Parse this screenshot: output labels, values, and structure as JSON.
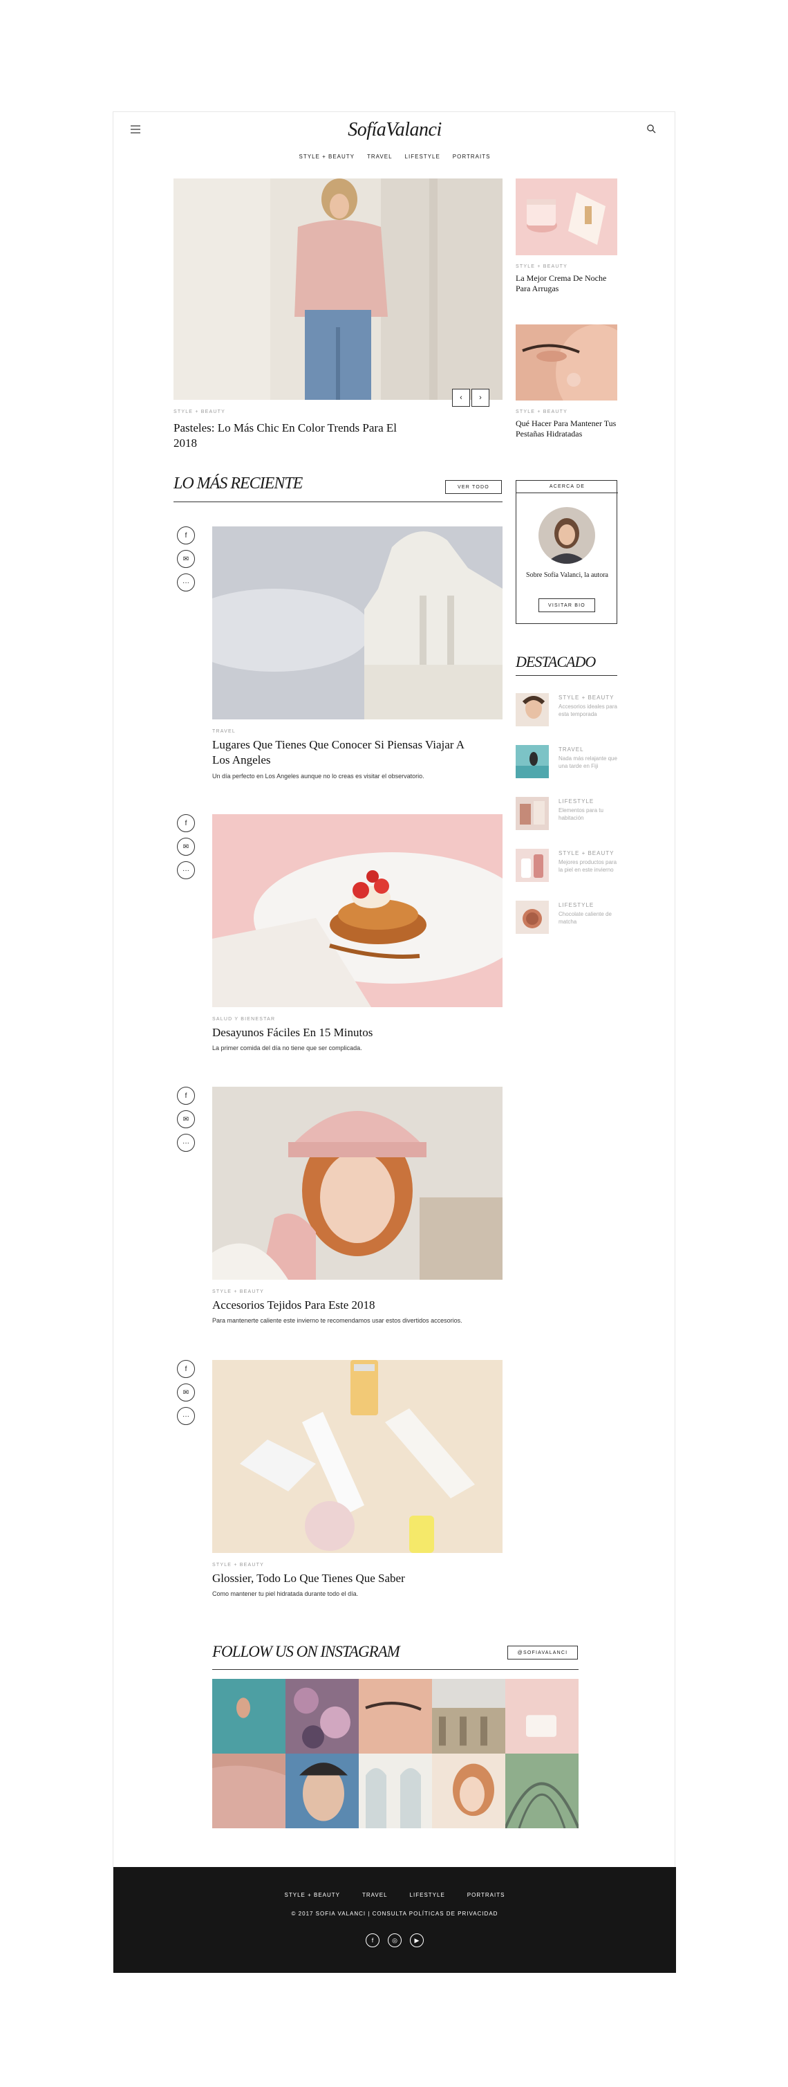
{
  "brand": {
    "logo": "SofíaValanci"
  },
  "nav": [
    "STYLE + BEAUTY",
    "TRAVEL",
    "LIFESTYLE",
    "PORTRAITS"
  ],
  "hero": {
    "category": "STYLE + BEAUTY",
    "title": "Pasteles: Lo Más Chic En Color Trends Para El 2018",
    "prev": "‹",
    "next": "›"
  },
  "side_posts": [
    {
      "category": "STYLE + BEAUTY",
      "title": "La Mejor Crema De Noche Para Arrugas"
    },
    {
      "category": "STYLE + BEAUTY",
      "title": "Qué Hacer Para Mantener Tus Pestañas Hidratadas"
    }
  ],
  "recent": {
    "title": "LO MÁS RECIENTE",
    "view_all": "VER TODO"
  },
  "posts": [
    {
      "category": "TRAVEL",
      "title": "Lugares Que Tienes Que Conocer Si Piensas Viajar A Los Angeles",
      "excerpt": "Un día perfecto en Los Angeles aunque no lo creas es visitar el observatorio."
    },
    {
      "category": "SALUD Y BIENESTAR",
      "title": "Desayunos Fáciles En 15 Minutos",
      "excerpt": "La primer comida del día no tiene que ser complicada."
    },
    {
      "category": "STYLE + BEAUTY",
      "title": "Accesorios Tejidos Para Este 2018",
      "excerpt": "Para mantenerte caliente este invierno te recomendamos usar estos divertidos accesorios."
    },
    {
      "category": "STYLE + BEAUTY",
      "title": "Glossier, Todo Lo Que Tienes Que Saber",
      "excerpt": "Como mantener tu piel hidratada durante todo el día."
    }
  ],
  "share_icons": [
    "f",
    "✉",
    "···"
  ],
  "about": {
    "header": "ACERCA DE",
    "text": "Sobre Sofía Valanci, la autora",
    "button": "VISITAR BIO"
  },
  "featured": {
    "title": "DESTACADO",
    "items": [
      {
        "category": "STYLE + BEAUTY",
        "text": "Accesorios ideales para esta temporada"
      },
      {
        "category": "TRAVEL",
        "text": "Nada más relajante que una tarde en Fiji"
      },
      {
        "category": "LIFESTYLE",
        "text": "Elementos para tu habitación"
      },
      {
        "category": "STYLE + BEAUTY",
        "text": "Mejores productos para la piel en este invierno"
      },
      {
        "category": "LIFESTYLE",
        "text": "Chocolate caliente de matcha"
      }
    ]
  },
  "instagram": {
    "title": "FOLLOW US ON INSTAGRAM",
    "handle": "@SOFIAVALANCI"
  },
  "footer": {
    "nav": [
      "STYLE + BEAUTY",
      "TRAVEL",
      "LIFESTYLE",
      "PORTRAITS"
    ],
    "copyright": "© 2017 SOFIA VALANCI  |  CONSULTA POLÍTICAS DE PRIVACIDAD",
    "social": [
      "f",
      "◎",
      "▶"
    ]
  },
  "colors": {
    "accent": "#161616",
    "blush": "#f2c9c6"
  }
}
